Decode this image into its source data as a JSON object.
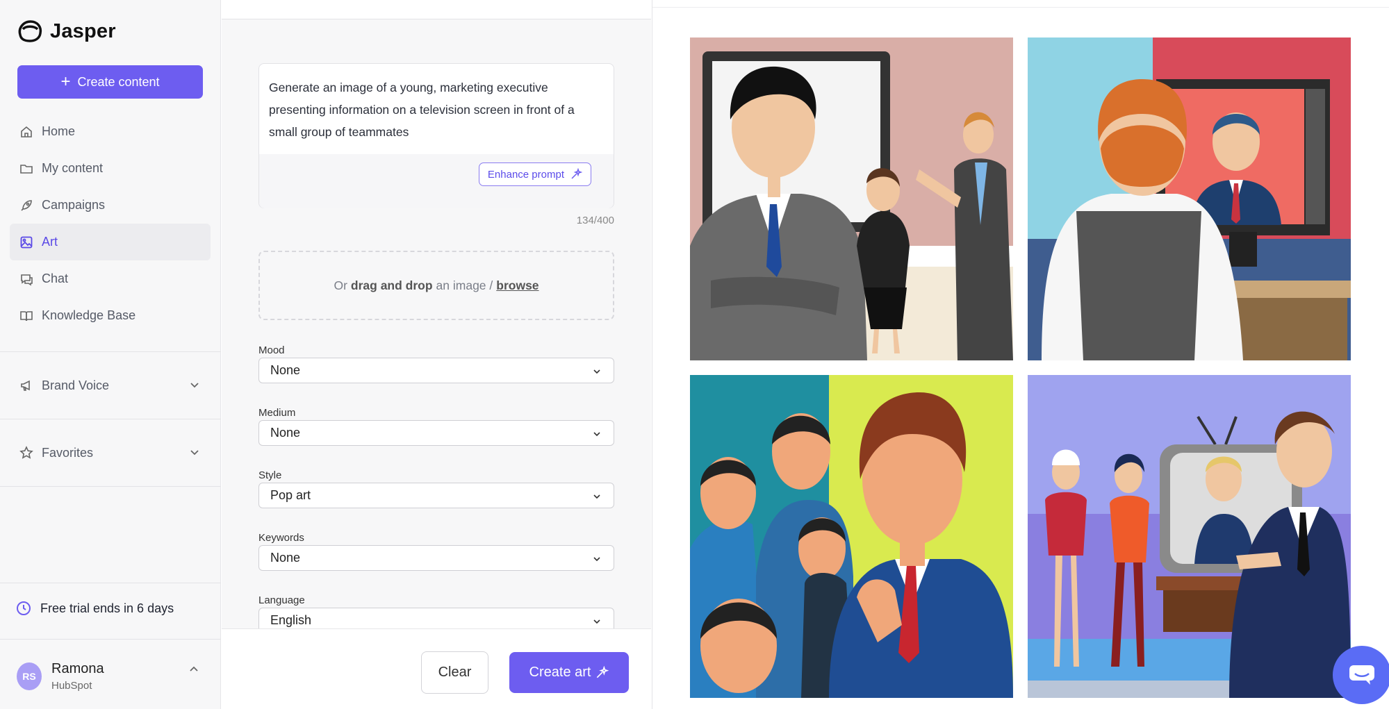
{
  "app": {
    "name": "Jasper"
  },
  "sidebar": {
    "create_label": "Create content",
    "nav": [
      {
        "label": "Home",
        "icon": "home-icon"
      },
      {
        "label": "My content",
        "icon": "folder-icon"
      },
      {
        "label": "Campaigns",
        "icon": "rocket-icon"
      },
      {
        "label": "Art",
        "icon": "image-icon",
        "active": true
      },
      {
        "label": "Chat",
        "icon": "chat-icon"
      },
      {
        "label": "Knowledge Base",
        "icon": "book-icon"
      }
    ],
    "brand_voice": "Brand Voice",
    "favorites": "Favorites",
    "trial": "Free trial ends in 6 days",
    "user": {
      "initials": "RS",
      "name": "Ramona",
      "org": "HubSpot"
    }
  },
  "form": {
    "prompt": "Generate an image of a young, marketing executive presenting information on a television screen in front of a small group of teammates",
    "enhance_label": "Enhance prompt",
    "counter": "134/400",
    "dropzone": {
      "prefix": "Or",
      "bold": "drag and drop",
      "middle": "an image /",
      "link": "browse"
    },
    "fields": [
      {
        "label": "Mood",
        "value": "None"
      },
      {
        "label": "Medium",
        "value": "None"
      },
      {
        "label": "Style",
        "value": "Pop art"
      },
      {
        "label": "Keywords",
        "value": "None"
      },
      {
        "label": "Language",
        "value": "English"
      }
    ],
    "clear_label": "Clear",
    "create_art_label": "Create art"
  },
  "colors": {
    "accent": "#6d5df0",
    "chat": "#5a6cf5"
  }
}
